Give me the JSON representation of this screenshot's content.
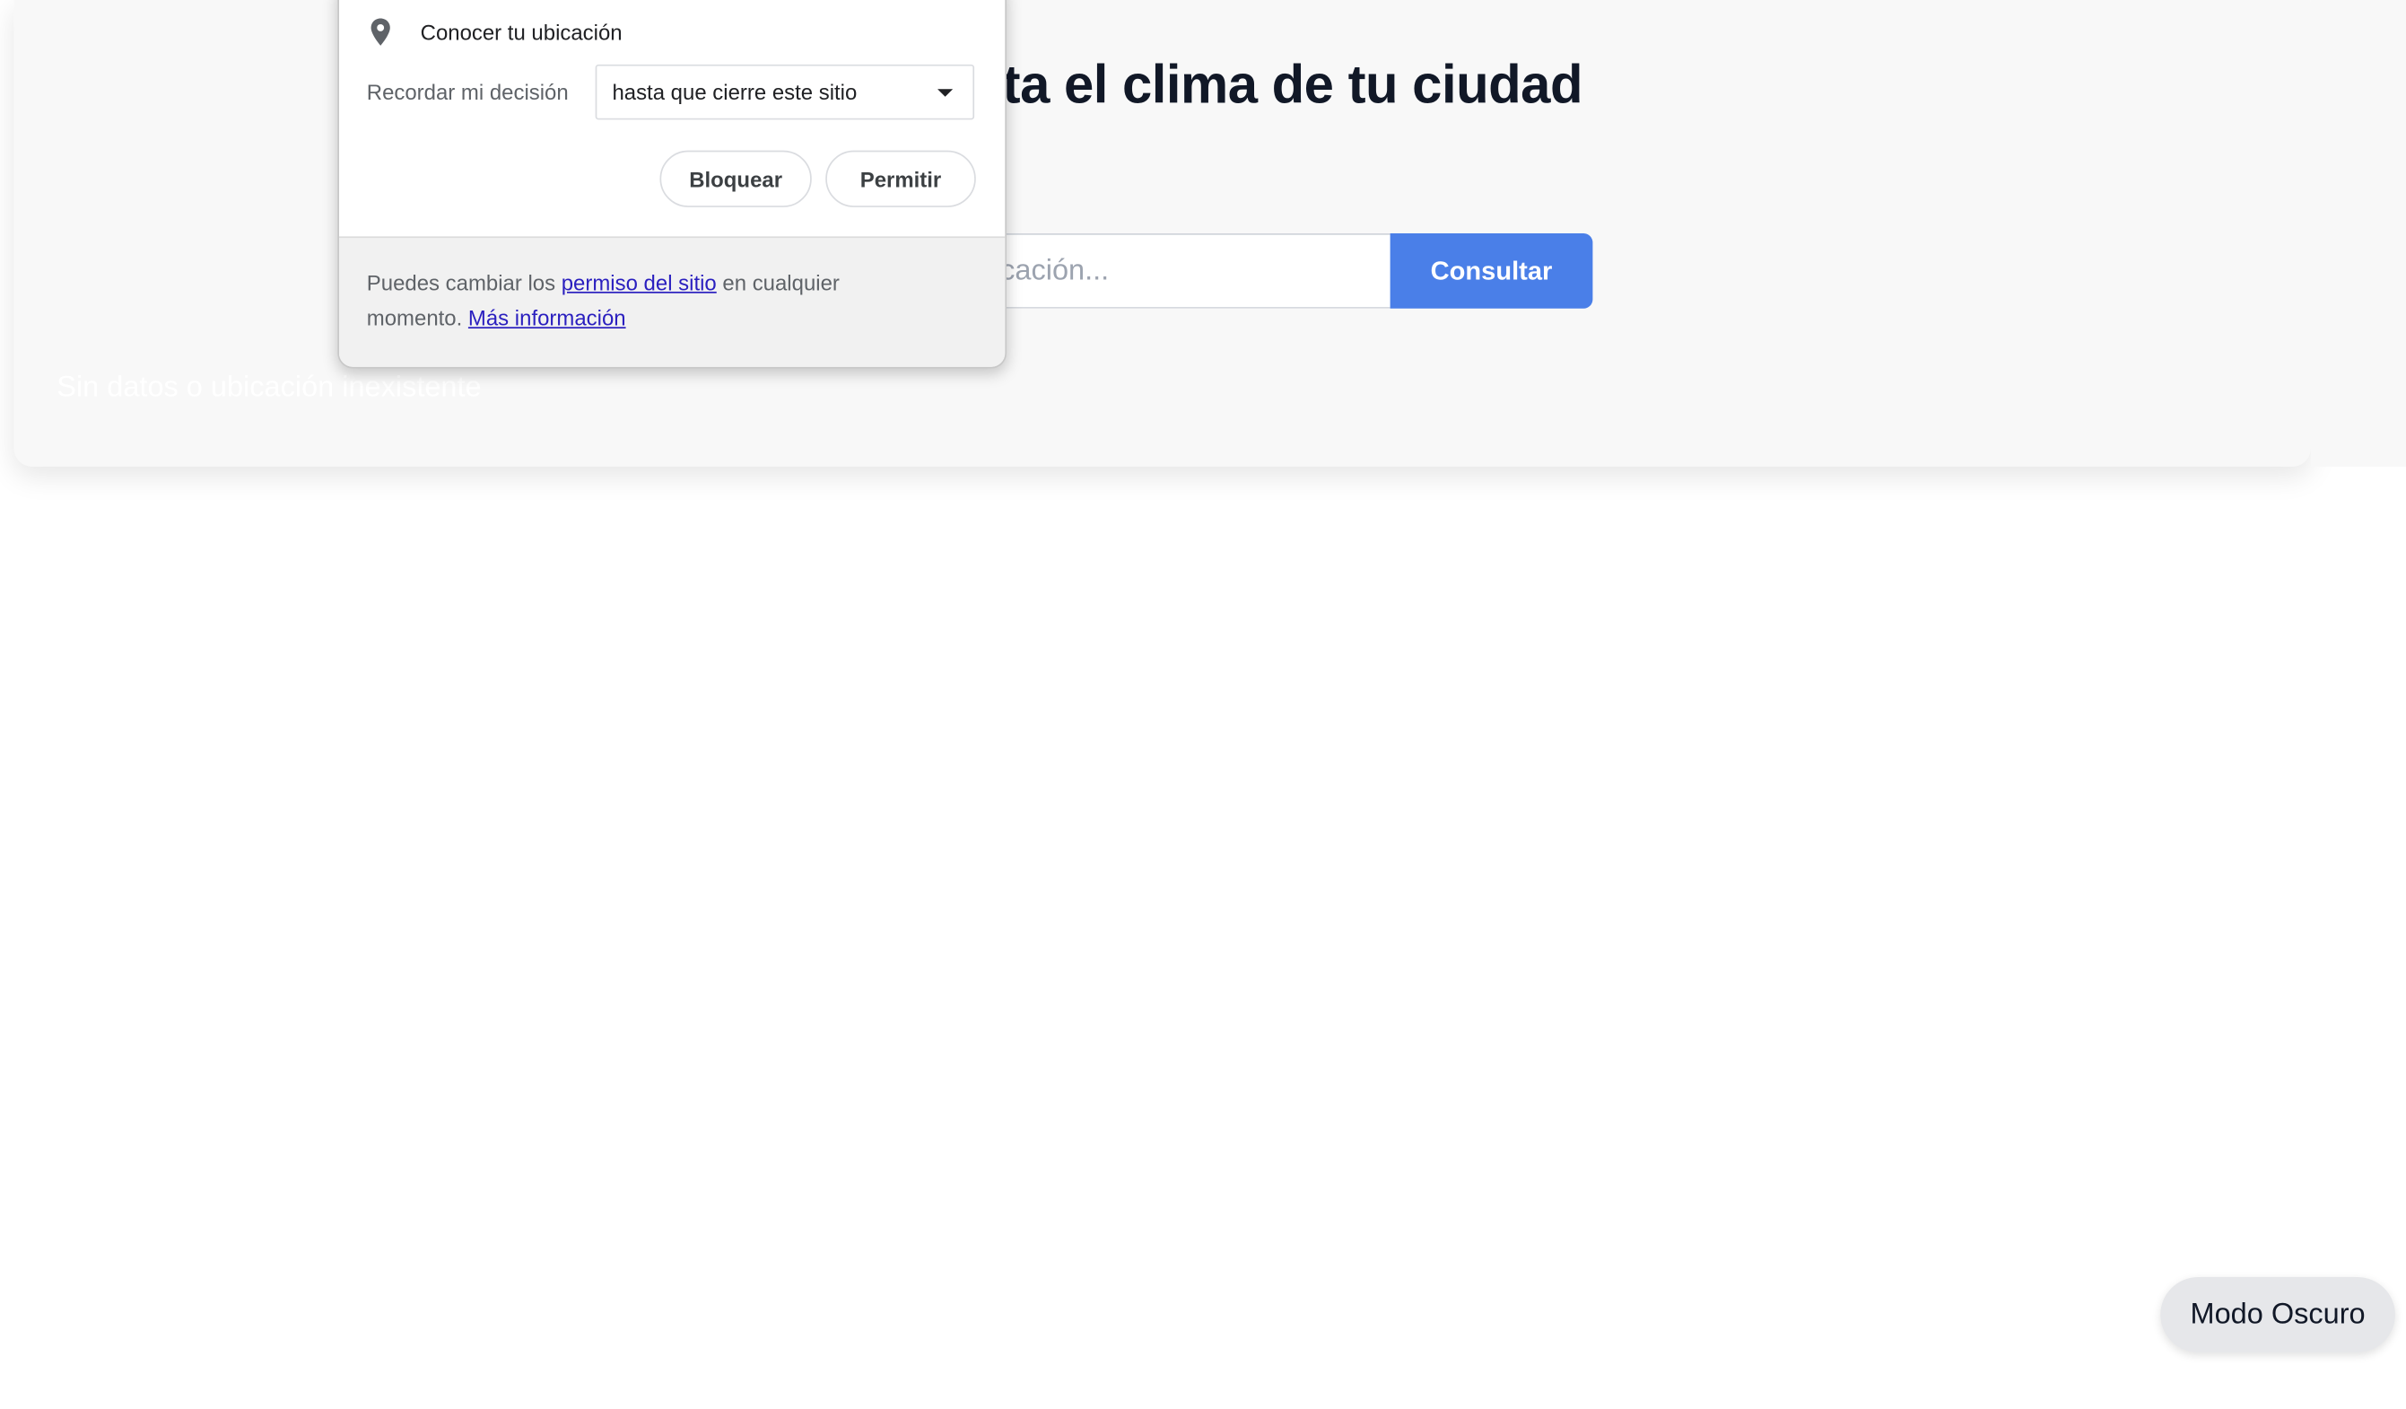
{
  "header": {
    "title": "Consulta el clima de tu ciudad"
  },
  "search": {
    "placeholder": "Ingresa una ubicación...",
    "value": "",
    "button_label": "Consultar"
  },
  "status": {
    "message": "Sin datos o ubicación inexistente"
  },
  "permission_popup": {
    "request_label": "Conocer tu ubicación",
    "remember_label": "Recordar mi decisión",
    "remember_selected": "hasta que cierre este sitio",
    "block_label": "Bloquear",
    "allow_label": "Permitir",
    "footer_before": "Puedes cambiar los ",
    "footer_link": "permiso del sitio",
    "footer_middle": " en cualquier momento. ",
    "footer_more_link": "Más información"
  },
  "theme_toggle": {
    "label": "Modo Oscuro"
  },
  "icons": {
    "location": "location-pin-icon",
    "dropdown": "caret-down-icon"
  },
  "colors": {
    "accent": "#4a7fe8",
    "card_background": "#f8f8f8",
    "title": "#111827",
    "link": "#2a1fbf"
  }
}
